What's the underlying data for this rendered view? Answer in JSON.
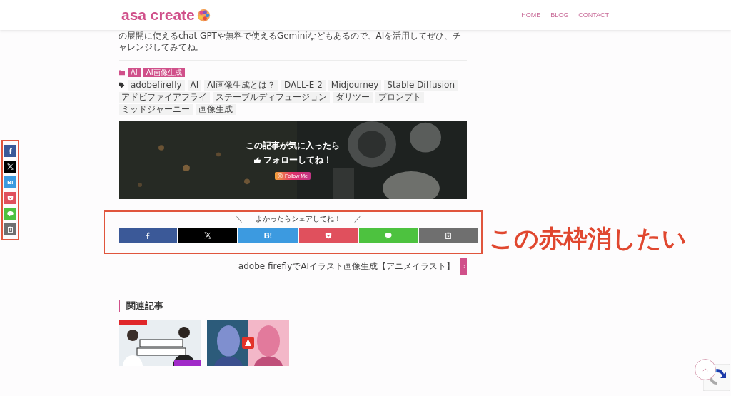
{
  "header": {
    "logo": "asa create",
    "nav": [
      {
        "label": "HOME"
      },
      {
        "label": "BLOG"
      },
      {
        "label": "CONTACT"
      }
    ]
  },
  "intro_text": "の展開に使えるchat GPTや無料で使えるGeminiなどもあるので、AIを活用してぜひ、チャレンジしてみてね。",
  "categories": [
    "AI",
    "AI画像生成"
  ],
  "tags": [
    "adobefirefly",
    "AI",
    "AI画像生成とは？",
    "DALL-E 2",
    "Midjourney",
    "Stable Diffusion",
    "アドビファイアフライ",
    "ステーブルディフュージョン",
    "ダリツー",
    "プロンプト",
    "ミッドジャーニー",
    "画像生成"
  ],
  "follow_banner": {
    "line1": "この記事が気に入ったら",
    "line2": "フォローしてね！",
    "button": "Follow Me"
  },
  "share": {
    "deco_left": "＼",
    "title": "よかったらシェアしてね！",
    "deco_right": "／",
    "buttons": [
      {
        "kind": "facebook"
      },
      {
        "kind": "x"
      },
      {
        "kind": "hatena",
        "label": "B!"
      },
      {
        "kind": "pocket"
      },
      {
        "kind": "line"
      },
      {
        "kind": "copy"
      }
    ]
  },
  "floating_share": [
    {
      "kind": "facebook"
    },
    {
      "kind": "x"
    },
    {
      "kind": "hatena",
      "label": "B!"
    },
    {
      "kind": "pocket"
    },
    {
      "kind": "line"
    },
    {
      "kind": "copy"
    }
  ],
  "next_post": {
    "title": "adobe fireflyでAIイラスト画像生成【アニメイラスト】"
  },
  "related": {
    "heading": "関連記事"
  },
  "annotation": {
    "text": "この赤枠消したい"
  }
}
